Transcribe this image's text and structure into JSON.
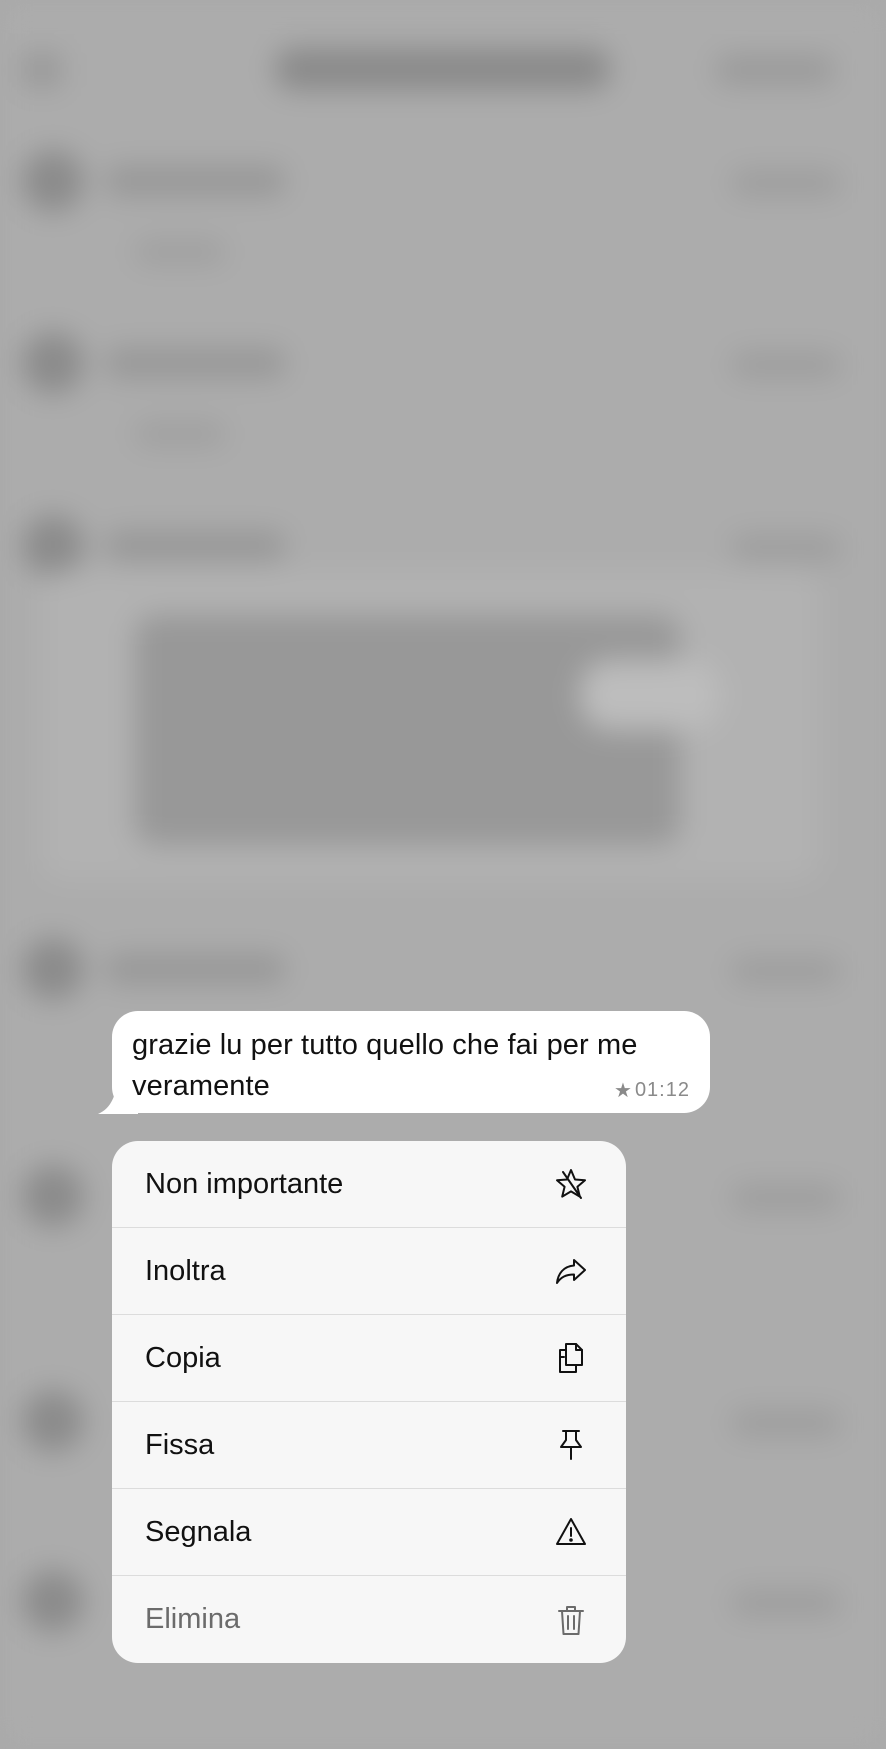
{
  "message": {
    "text": "grazie lu per tutto quello che fai per me veramente",
    "time": "01:12",
    "starred_icon": "star-icon"
  },
  "menu": {
    "items": [
      {
        "label": "Non importante",
        "icon": "unstar-icon"
      },
      {
        "label": "Inoltra",
        "icon": "forward-icon"
      },
      {
        "label": "Copia",
        "icon": "copy-icon"
      },
      {
        "label": "Fissa",
        "icon": "pin-icon"
      },
      {
        "label": "Segnala",
        "icon": "warning-icon"
      },
      {
        "label": "Elimina",
        "icon": "trash-icon"
      }
    ]
  },
  "colors": {
    "backdrop": "#a9a9a9",
    "bubble": "#ffffff",
    "menu": "#f7f7f7",
    "muted_label": "#6b6b6b"
  }
}
